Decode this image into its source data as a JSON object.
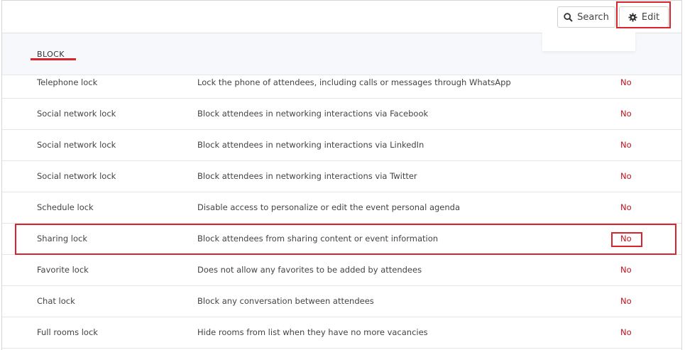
{
  "toolbar": {
    "search_label": "Search",
    "edit_label": "Edit",
    "search_icon": "search-icon",
    "edit_icon": "gear-icon"
  },
  "section": {
    "title": "BLOCK"
  },
  "rows": [
    {
      "name": "Telephone lock",
      "description": "Lock the phone of attendees, including calls or messages through WhatsApp",
      "value": "No"
    },
    {
      "name": "Social network lock",
      "description": "Block attendees in networking interactions via Facebook",
      "value": "No"
    },
    {
      "name": "Social network lock",
      "description": "Block attendees in networking interactions via LinkedIn",
      "value": "No"
    },
    {
      "name": "Social network lock",
      "description": "Block attendees in networking interactions via Twitter",
      "value": "No"
    },
    {
      "name": "Schedule lock",
      "description": "Disable access to personalize or edit the event personal agenda",
      "value": "No"
    },
    {
      "name": "Sharing lock",
      "description": "Block attendees from sharing content or event information",
      "value": "No"
    },
    {
      "name": "Favorite lock",
      "description": "Does not allow any favorites to be added by attendees",
      "value": "No"
    },
    {
      "name": "Chat lock",
      "description": "Block any conversation between attendees",
      "value": "No"
    },
    {
      "name": "Full rooms lock",
      "description": "Hide rooms from list when they have no more vacancies",
      "value": "No"
    }
  ],
  "colors": {
    "accent_red": "#d9232e",
    "value_red": "#c0101c",
    "header_bg": "#f6f8fb"
  }
}
